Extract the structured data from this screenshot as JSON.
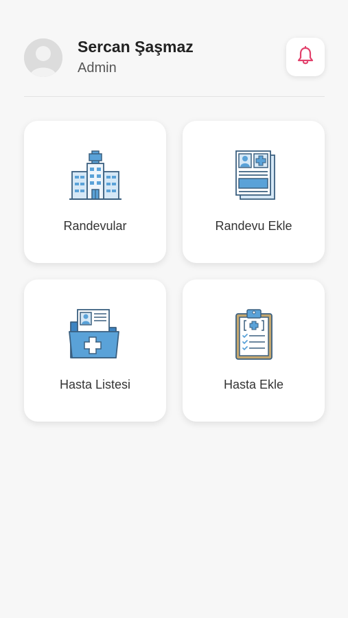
{
  "user": {
    "name": "Sercan Şaşmaz",
    "role": "Admin",
    "avatar_icon": "user-avatar-icon"
  },
  "header": {
    "notification_icon": "bell-icon",
    "accent_color": "#e2406b"
  },
  "menu": {
    "items": [
      {
        "label": "Randevular",
        "icon": "hospital-icon"
      },
      {
        "label": "Randevu Ekle",
        "icon": "medical-record-icon"
      },
      {
        "label": "Hasta Listesi",
        "icon": "patient-folder-icon"
      },
      {
        "label": "Hasta Ekle",
        "icon": "clipboard-icon"
      }
    ]
  },
  "colors": {
    "icon_blue": "#5aa2d8",
    "icon_light_blue": "#d6e8f6",
    "icon_outline": "#3a5f7f",
    "background": "#f7f7f7"
  }
}
